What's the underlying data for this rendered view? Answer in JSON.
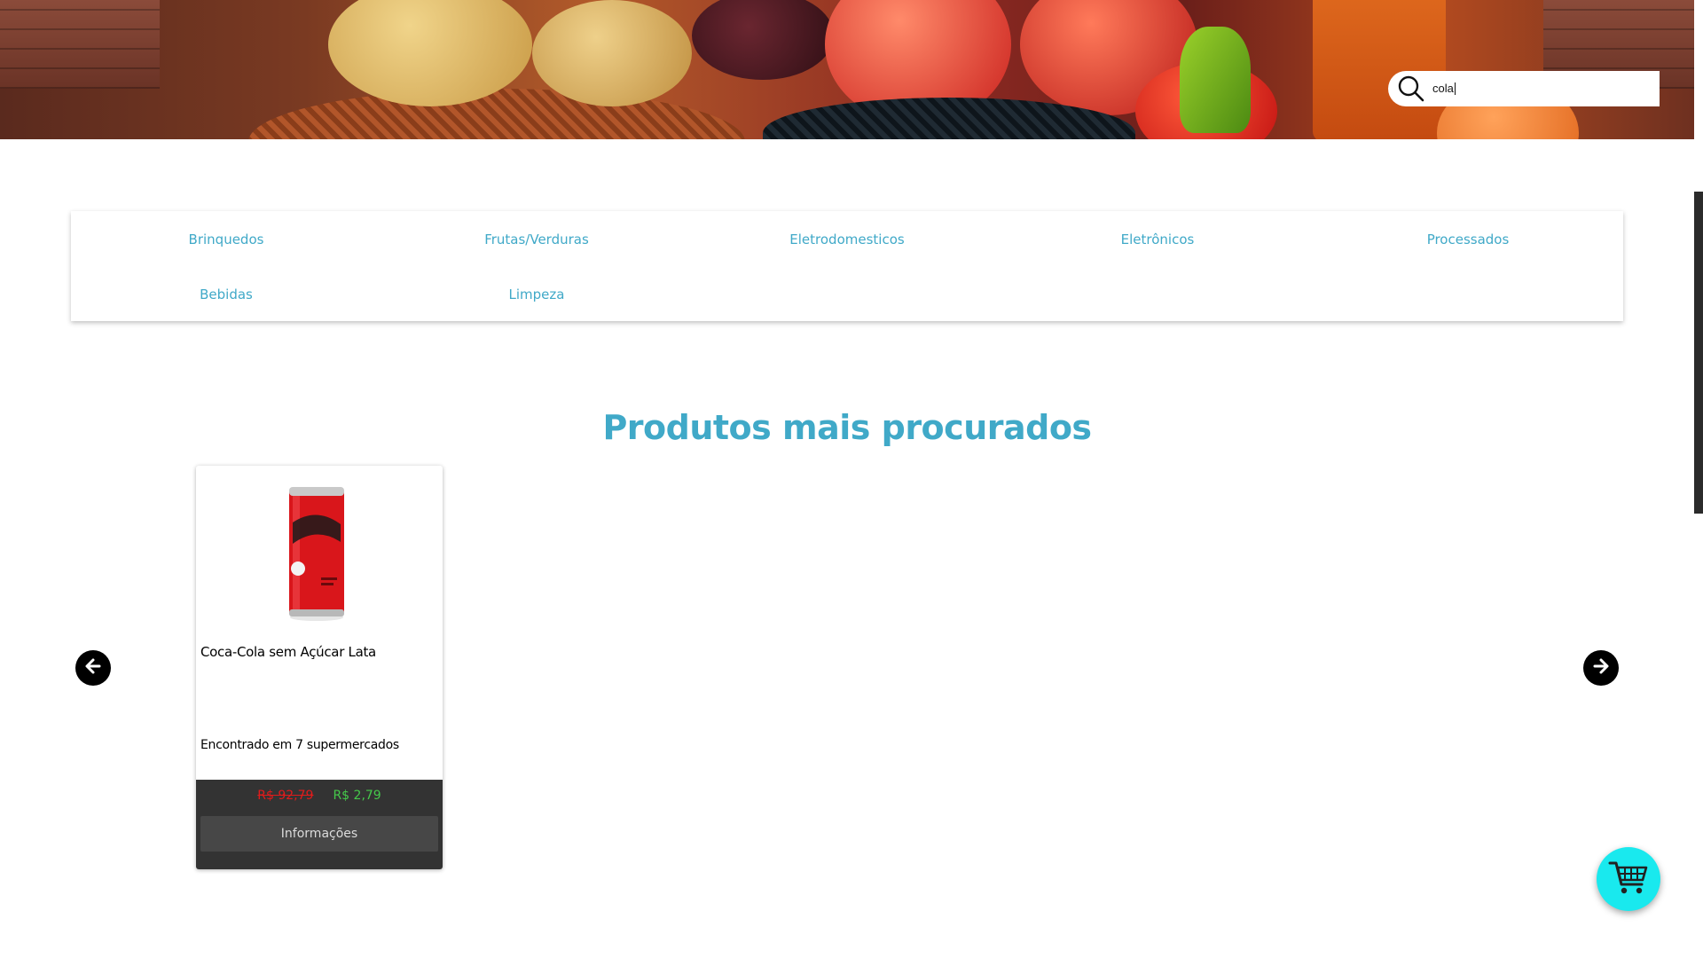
{
  "hero": {
    "search": {
      "value": "cola"
    }
  },
  "categories": [
    {
      "label": "Brinquedos"
    },
    {
      "label": "Frutas/Verduras"
    },
    {
      "label": "Eletrodomesticos"
    },
    {
      "label": "Eletrônicos"
    },
    {
      "label": "Processados"
    },
    {
      "label": "Bebidas"
    },
    {
      "label": "Limpeza"
    }
  ],
  "section": {
    "title": "Produtos mais procurados"
  },
  "products": [
    {
      "name": "Coca-Cola sem Açúcar Lata",
      "found_in": "Encontrado em 7 supermercados",
      "price_old": "R$ 92,79",
      "price_new": "R$ 2,79",
      "info_label": "Informações",
      "image_icon": "soda-can-icon"
    }
  ],
  "colors": {
    "accent": "#40a9c8",
    "card_footer": "#333333",
    "price_old": "#e01b1b",
    "price_new": "#45c84a",
    "cart_fab": "#19e9ee"
  },
  "icons": {
    "search": "search-icon",
    "prev": "arrow-left-icon",
    "next": "arrow-right-icon",
    "cart": "shopping-cart-icon"
  }
}
